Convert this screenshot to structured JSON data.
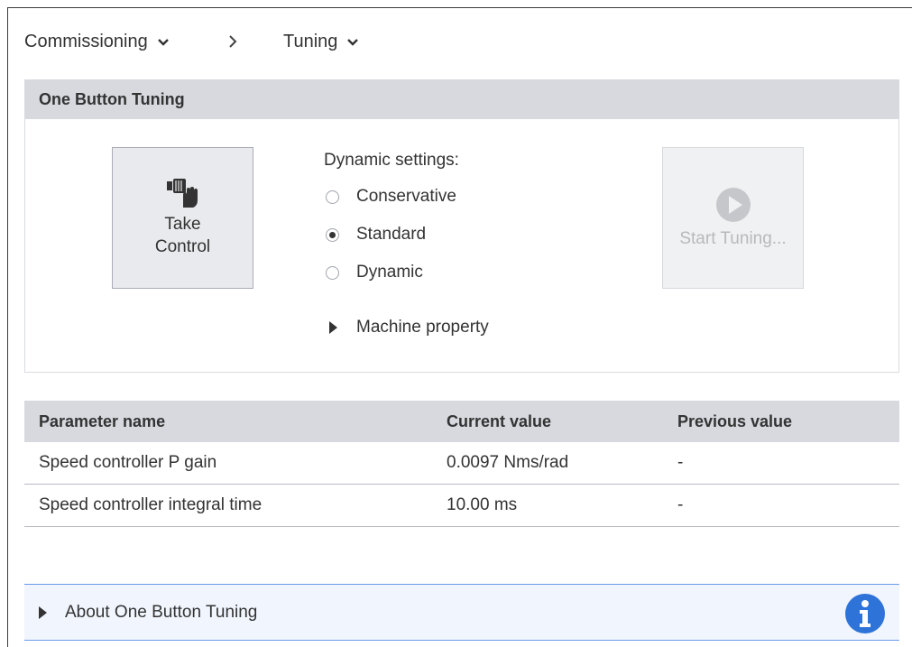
{
  "breadcrumb": {
    "items": [
      "Commissioning",
      "Tuning"
    ],
    "separator": "›"
  },
  "obt": {
    "title": "One Button Tuning",
    "take_control": {
      "line1": "Take",
      "line2": "Control"
    },
    "dynamic_settings_label": "Dynamic settings:",
    "options": [
      {
        "label": "Conservative",
        "selected": false
      },
      {
        "label": "Standard",
        "selected": true
      },
      {
        "label": "Dynamic",
        "selected": false
      }
    ],
    "machine_property_label": "Machine property",
    "start_tuning_label": "Start Tuning..."
  },
  "table": {
    "headers": [
      "Parameter name",
      "Current value",
      "Previous value"
    ],
    "rows": [
      [
        "Speed controller P gain",
        "0.0097 Nms/rad",
        "-"
      ],
      [
        "Speed controller integral time",
        "10.00 ms",
        "-"
      ]
    ]
  },
  "about": {
    "label": "About One Button Tuning"
  },
  "colors": {
    "header_bg": "#d7d9de",
    "accent_blue": "#2d73d8",
    "about_border": "#6b9be8"
  }
}
